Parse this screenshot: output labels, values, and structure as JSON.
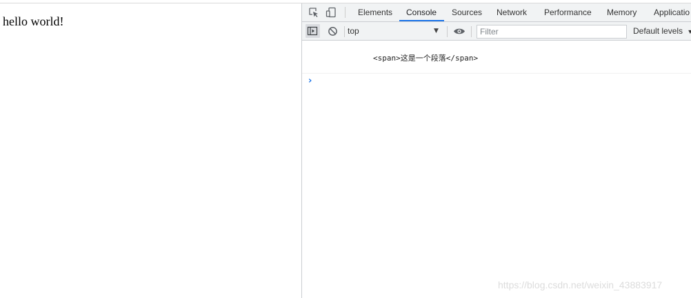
{
  "page": {
    "body_text": "hello world!"
  },
  "devtools": {
    "tabs": [
      {
        "label": "Elements",
        "active": false
      },
      {
        "label": "Console",
        "active": true
      },
      {
        "label": "Sources",
        "active": false
      },
      {
        "label": "Network",
        "active": false
      },
      {
        "label": "Performance",
        "active": false
      },
      {
        "label": "Memory",
        "active": false
      },
      {
        "label": "Applicatio",
        "active": false
      }
    ],
    "toolbar": {
      "context": "top",
      "filter_placeholder": "Filter",
      "levels_label": "Default levels"
    },
    "console": {
      "messages": [
        {
          "text": "<span>这是一个段落</span>"
        }
      ],
      "prompt_symbol": "›"
    },
    "icons": {
      "inspect": "inspect-element-icon",
      "device": "device-toolbar-icon",
      "sidebar": "console-sidebar-icon",
      "clear": "clear-console-icon",
      "eye": "live-expression-eye-icon",
      "dropdown": "chevron-down-icon"
    },
    "colors": {
      "accent": "#1a73e8",
      "toolbar_bg": "#f1f3f4",
      "border": "#cacdd1"
    }
  },
  "watermark": {
    "text": "https://blog.csdn.net/weixin_43883917"
  }
}
